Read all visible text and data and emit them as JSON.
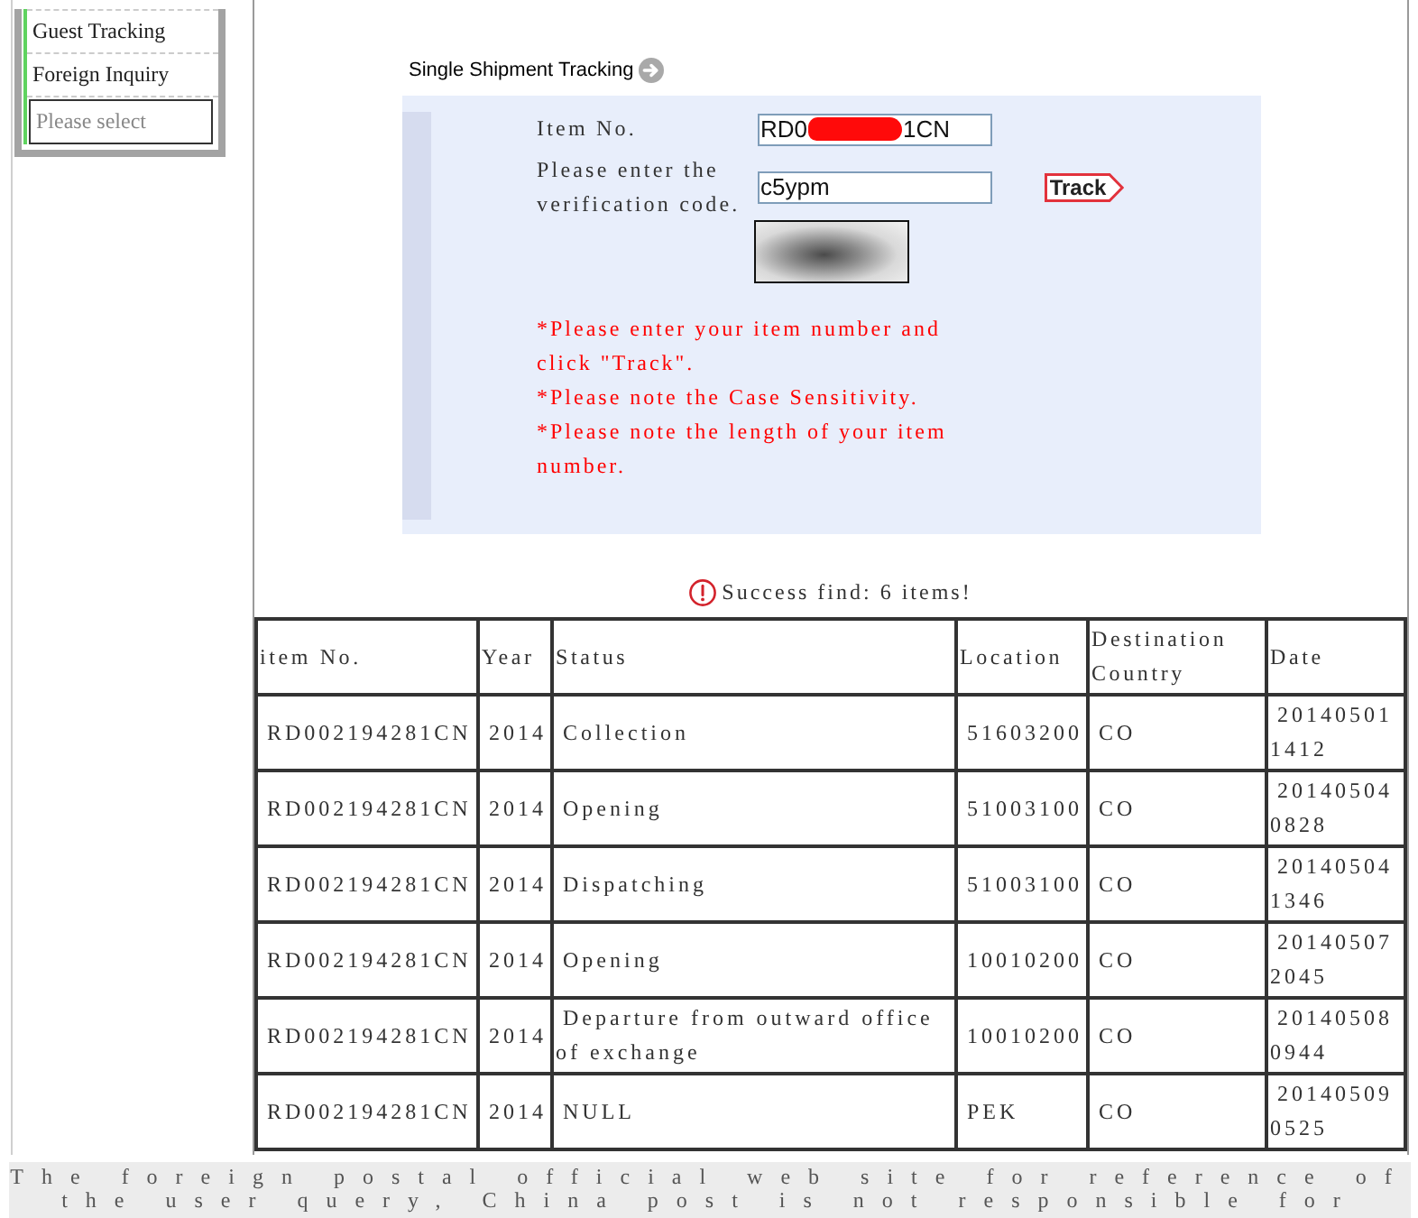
{
  "sidebar": {
    "items": [
      {
        "label": "Guest Tracking"
      },
      {
        "label": "Foreign Inquiry"
      }
    ],
    "select": {
      "placeholder": "Please select"
    }
  },
  "tracking_form": {
    "title": "Single Shipment Tracking",
    "fields": [
      {
        "kind": "redacted",
        "label": "Item No.",
        "value_start": "RD0",
        "value_end": "1CN"
      },
      {
        "kind": "text",
        "label": "Please enter the verification code.",
        "value": "c5ypm"
      }
    ],
    "track_button": "Track",
    "notes": [
      "*Please enter your item number and click \"Track\".",
      "*Please note the Case Sensitivity.",
      "*Please note the length of your item number."
    ]
  },
  "result": {
    "message": "Success find: 6 items!"
  },
  "table": {
    "columns": [
      "item No.",
      "Year",
      "Status",
      "Location",
      "Destination Country",
      "Date"
    ],
    "rows": [
      [
        "RD002194281CN",
        "2014",
        "Collection",
        "51603200",
        "CO",
        "20140501 1412"
      ],
      [
        "RD002194281CN",
        "2014",
        "Opening",
        "51003100",
        "CO",
        "20140504 0828"
      ],
      [
        "RD002194281CN",
        "2014",
        "Dispatching",
        "51003100",
        "CO",
        "20140504 1346"
      ],
      [
        "RD002194281CN",
        "2014",
        "Opening",
        "10010200",
        "CO",
        "20140507 2045"
      ],
      [
        "RD002194281CN",
        "2014",
        "Departure from outward office of exchange",
        "10010200",
        "CO",
        "20140508 0944"
      ],
      [
        "RD002194281CN",
        "2014",
        "NULL",
        "PEK",
        "CO",
        "20140509 0525"
      ]
    ]
  },
  "footer": {
    "text": "The foreign postal official web site for reference of the user query, China post is not responsible for"
  }
}
